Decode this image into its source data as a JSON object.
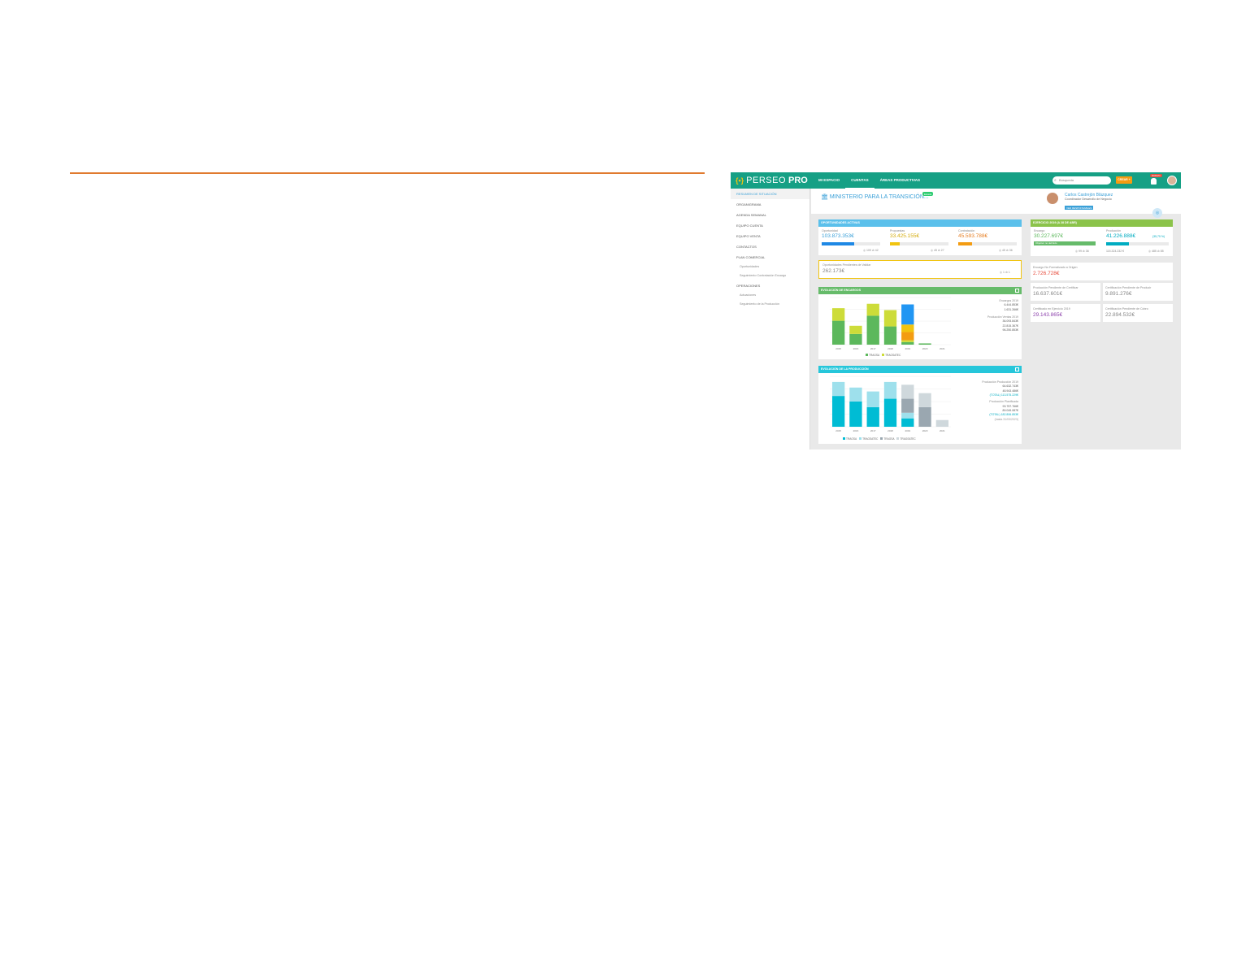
{
  "app": {
    "logo_text": "PERSEO",
    "logo_suffix": "PRO",
    "logo_mark": "{•}"
  },
  "nav": [
    {
      "label": "MI ESPACIO"
    },
    {
      "label": "CUENTAS"
    },
    {
      "label": "ÁREAS PRODUCTIVAS"
    }
  ],
  "search": {
    "placeholder": "Búsqueda"
  },
  "new_button": "CREAR +",
  "alert_badge": "NUEVO",
  "sidebar": {
    "items": [
      {
        "label": "RESUMEN DE SITUACIÓN"
      },
      {
        "label": "ORGANIGRAMA"
      },
      {
        "label": "AGENDA SEMANAL"
      },
      {
        "label": "EQUIPO CUENTA"
      },
      {
        "label": "EQUIPO VENTA"
      },
      {
        "label": "CONTACTOS"
      },
      {
        "label": "PLAN COMERCIAL"
      },
      {
        "label": "Oportunidades"
      },
      {
        "label": "Seguimiento Contratación Encargo"
      },
      {
        "label": "OPERACIONES"
      },
      {
        "label": "Actuaciones"
      },
      {
        "label": "Seguimiento de la Producción"
      }
    ]
  },
  "header": {
    "title": "MINISTERIO PARA LA TRANSICIÓN...",
    "badge": "Estado",
    "person_name": "Carlos Castrejón Blázquez",
    "person_role": "Coordinador Desarrollo de Negocio",
    "person_button": "VER RESPONSABLES"
  },
  "oportunidades": {
    "title": "OPORTUNIDADES ACTIVAS",
    "items": [
      {
        "label": "Oportunidad",
        "value": "103.873.353€",
        "count": "◎ 109 ⊘ 42",
        "fill": 0.55,
        "color": "#1e88e5"
      },
      {
        "label": "Propuestas",
        "value": "33.425.155€",
        "count": "◎ 45 ⊘ 27",
        "fill": 0.17,
        "color": "#f1c40f"
      },
      {
        "label": "Contratación",
        "value": "45.593.788€",
        "count": "◎ 45 ⊘ 36",
        "fill": 0.23,
        "color": "#f39c12"
      }
    ],
    "pending_label": "Oportunidades Pendientes de Validar",
    "pending_value": "262.173€",
    "pending_count": "◎ 1 ⊘ 1"
  },
  "ejercicio": {
    "title": "EJERCICIO 2019 (A 28 DE ABR)",
    "encargo_label": "Encargo",
    "encargo_value": "30.227.697€",
    "encargo_note": "Objetivo no definido",
    "encargo_count": "◎ 99 ⊘ 36",
    "produccion_label": "Producción",
    "produccion_value": "41.226.888€",
    "produccion_pct": "(35,75 %)",
    "produccion_fill": 0.36,
    "produccion_obj": "115.324.232 €",
    "produccion_count": "◎ 485 ⊘ 85"
  },
  "encargo_formalizado": {
    "label": "Encargo No Formalizado a Origen",
    "value": "2.726.728€"
  },
  "stat_cards": [
    {
      "label": "Producción Pendiente de Certificar",
      "value": "16.637.601€",
      "color": "#888888"
    },
    {
      "label": "Certificación Pendiente de Producir",
      "value": "9.891.276€",
      "color": "#888888"
    },
    {
      "label": "Certificado en Ejercicio 2019",
      "value": "29.143.865€",
      "color": "#8e44ad"
    },
    {
      "label": "Certificación Pendiente de Cobro",
      "value": "22.894.532€",
      "color": "#888888"
    }
  ],
  "encargos_chart": {
    "title": "EVOLUCIÓN DE ENCARGOS",
    "side_title": "Encargos 2019",
    "side_values": [
      "6.444.853€",
      "1.631.266€"
    ],
    "side_title2": "Producción Ventas 2019",
    "side_values2": [
      "36.093.843€",
      "22.815.367€",
      "96.250.853€"
    ],
    "legend": [
      {
        "name": "TRAGSA",
        "color": "#5cb85c"
      },
      {
        "name": "TRAGSATEC",
        "color": "#cddc39"
      }
    ]
  },
  "produccion_chart": {
    "title": "EVOLUCIÓN DE LA PRODUCCIÓN",
    "side_title": "Producción Producción 2019",
    "side_values": [
      "64.632.743€",
      "48.943.486€",
      "(TOTAL) 113.575.229€"
    ],
    "side_title2": "Producción Planificada",
    "side_values2": [
      "93.757.766€",
      "89.049.087€",
      "(TOTAL) 182.806.853€"
    ],
    "side_note": "(hasta 31/03/2023)",
    "legend": [
      {
        "name": "TRAGSA",
        "color": "#00bcd4"
      },
      {
        "name": "TRAGSATEC",
        "color": "#9ee0ec"
      },
      {
        "name": "TRAGSA",
        "color": "#9aa7b0"
      },
      {
        "name": "TRAGSATEC",
        "color": "#cfd8dc"
      }
    ]
  },
  "chart_data": [
    {
      "type": "bar",
      "title": "EVOLUCIÓN DE ENCARGOS",
      "categories": [
        "2015",
        "2016",
        "2017",
        "2018",
        "2019",
        "2020",
        "2021"
      ],
      "stacked": true,
      "series": [
        {
          "name": "TRAGSA",
          "values": [
            38,
            17,
            46,
            29,
            4,
            2,
            0
          ],
          "color": "#5cb85c"
        },
        {
          "name": "TRAGSATEC",
          "values": [
            20,
            13,
            19,
            26,
            3,
            0,
            0
          ],
          "color": "#cddc39"
        },
        {
          "values": [
            0,
            0,
            0,
            0,
            13,
            0,
            0
          ],
          "color": "#f39c12"
        },
        {
          "values": [
            0,
            0,
            0,
            0,
            12,
            0,
            0
          ],
          "color": "#f1c40f"
        },
        {
          "values": [
            0,
            0,
            0,
            0,
            32,
            0,
            0
          ],
          "color": "#2196f3"
        }
      ],
      "ylim": [
        0,
        75
      ]
    },
    {
      "type": "bar",
      "title": "EVOLUCIÓN DE LA PRODUCCIÓN",
      "categories": [
        "2015",
        "2016",
        "2017",
        "2018",
        "2019",
        "2020",
        "2021"
      ],
      "stacked": true,
      "series": [
        {
          "name": "TRAGSA",
          "values": [
            55,
            45,
            35,
            50,
            15,
            0,
            0
          ],
          "color": "#00bcd4"
        },
        {
          "name": "TRAGSATEC",
          "values": [
            25,
            25,
            28,
            30,
            10,
            0,
            0
          ],
          "color": "#9ee0ec"
        },
        {
          "name": "TRAGSA",
          "values": [
            0,
            0,
            0,
            0,
            25,
            35,
            0
          ],
          "color": "#9aa7b0"
        },
        {
          "name": "TRAGSATEC",
          "values": [
            0,
            0,
            0,
            0,
            25,
            25,
            12
          ],
          "color": "#cfd8dc"
        }
      ],
      "ylim": [
        0,
        90
      ]
    }
  ]
}
